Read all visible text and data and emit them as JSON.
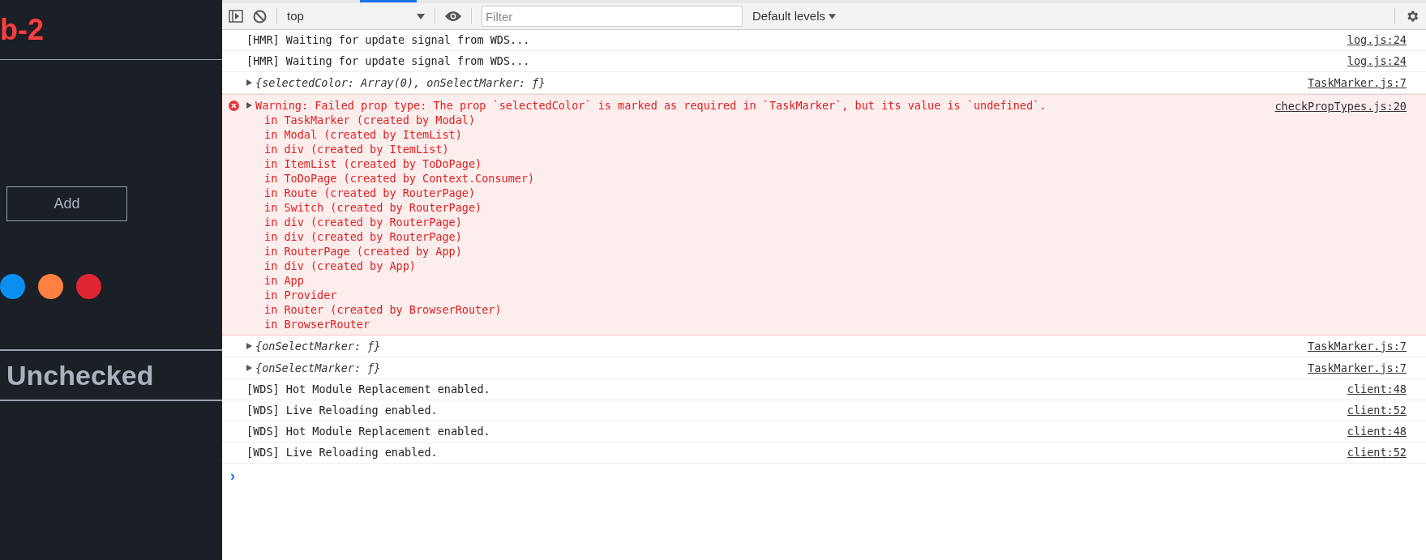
{
  "app": {
    "title": "b-2",
    "add_button": "Add",
    "color_markers": [
      {
        "color": "#0a8ff0"
      },
      {
        "color": "#ff8040"
      },
      {
        "color": "#e02535"
      }
    ],
    "section_title": "Unchecked"
  },
  "devtools": {
    "toolbar": {
      "context": "top",
      "filter_placeholder": "Filter",
      "levels": "Default levels"
    },
    "messages": [
      {
        "kind": "log",
        "text": "[HMR] Waiting for update signal from WDS...",
        "source": "log.js:24"
      },
      {
        "kind": "log",
        "text": "[HMR] Waiting for update signal from WDS...",
        "source": "log.js:24"
      },
      {
        "kind": "object",
        "text": "{selectedColor: Array(0), onSelectMarker: ƒ}",
        "source": "TaskMarker.js:7"
      },
      {
        "kind": "error",
        "text": "Warning: Failed prop type: The prop `selectedColor` is marked as required in `TaskMarker`, but its value is `undefined`.",
        "source": "checkPropTypes.js:20",
        "stack": [
          "in TaskMarker (created by Modal)",
          "in Modal (created by ItemList)",
          "in div (created by ItemList)",
          "in ItemList (created by ToDoPage)",
          "in ToDoPage (created by Context.Consumer)",
          "in Route (created by RouterPage)",
          "in Switch (created by RouterPage)",
          "in div (created by RouterPage)",
          "in div (created by RouterPage)",
          "in RouterPage (created by App)",
          "in div (created by App)",
          "in App",
          "in Provider",
          "in Router (created by BrowserRouter)",
          "in BrowserRouter"
        ]
      },
      {
        "kind": "object",
        "text": "{onSelectMarker: ƒ}",
        "source": "TaskMarker.js:7"
      },
      {
        "kind": "object",
        "text": "{onSelectMarker: ƒ}",
        "source": "TaskMarker.js:7"
      },
      {
        "kind": "log",
        "text": "[WDS] Hot Module Replacement enabled.",
        "source": "client:48"
      },
      {
        "kind": "log",
        "text": "[WDS] Live Reloading enabled.",
        "source": "client:52"
      },
      {
        "kind": "log",
        "text": "[WDS] Hot Module Replacement enabled.",
        "source": "client:48"
      },
      {
        "kind": "log",
        "text": "[WDS] Live Reloading enabled.",
        "source": "client:52"
      }
    ],
    "prompt": "›"
  }
}
